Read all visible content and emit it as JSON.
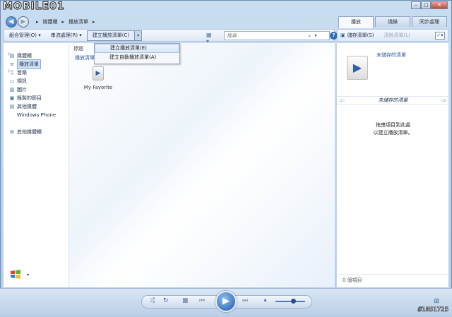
{
  "app": {
    "logo_text": "MOBILE01"
  },
  "window_controls": {
    "minimize": "–",
    "maximize": "□",
    "close": "✕"
  },
  "breadcrumb": [
    "媒體櫃",
    "播放清單"
  ],
  "tabs": [
    {
      "label": "播放",
      "active": true
    },
    {
      "label": "燒錄",
      "active": false
    },
    {
      "label": "同步處理",
      "active": false
    }
  ],
  "toolbar": {
    "organize": "組合管理(O)",
    "stream": "串流處理(R)",
    "create_playlist": "建立播放清單(C)",
    "search_placeholder": "搜尋"
  },
  "right_toolbar": {
    "save": "儲存清單(S)",
    "clear": "清除清單(L)"
  },
  "dropdown": {
    "items": [
      {
        "label": "建立播放清單(E)"
      },
      {
        "label": "建立自動播放清單(A)"
      }
    ]
  },
  "sidebar": {
    "items": [
      {
        "label": "媒體櫃",
        "icon": "library-icon"
      },
      {
        "label": "播放清單",
        "icon": "playlist-icon",
        "selected": true
      },
      {
        "label": "音樂",
        "icon": "music-icon"
      },
      {
        "label": "視訊",
        "icon": "video-icon"
      },
      {
        "label": "圖片",
        "icon": "picture-icon"
      },
      {
        "label": "錄製的節目",
        "icon": "recorded-tv-icon"
      },
      {
        "label": "其他媒體",
        "icon": "other-media-icon"
      },
      {
        "label": "Windows Phone",
        "icon": "device-icon"
      },
      {
        "label": "其他媒體櫃",
        "icon": "other-libraries-icon"
      }
    ]
  },
  "library": {
    "column_header": "標題",
    "sub_header": "播放清單",
    "playlist_name": "My Favorite"
  },
  "right_pane": {
    "unsaved_top": "未儲存的清單",
    "unsaved_title": "未儲存的清單",
    "drag_line1": "拖曳項目到此處",
    "drag_line2": "以建立播放清單。",
    "item_count": "0 個項目"
  },
  "watermark": "#1851725",
  "colors": {
    "accent": "#2f6bc1",
    "frame": "#c9ddf1",
    "selection": "#cfe2f8"
  }
}
